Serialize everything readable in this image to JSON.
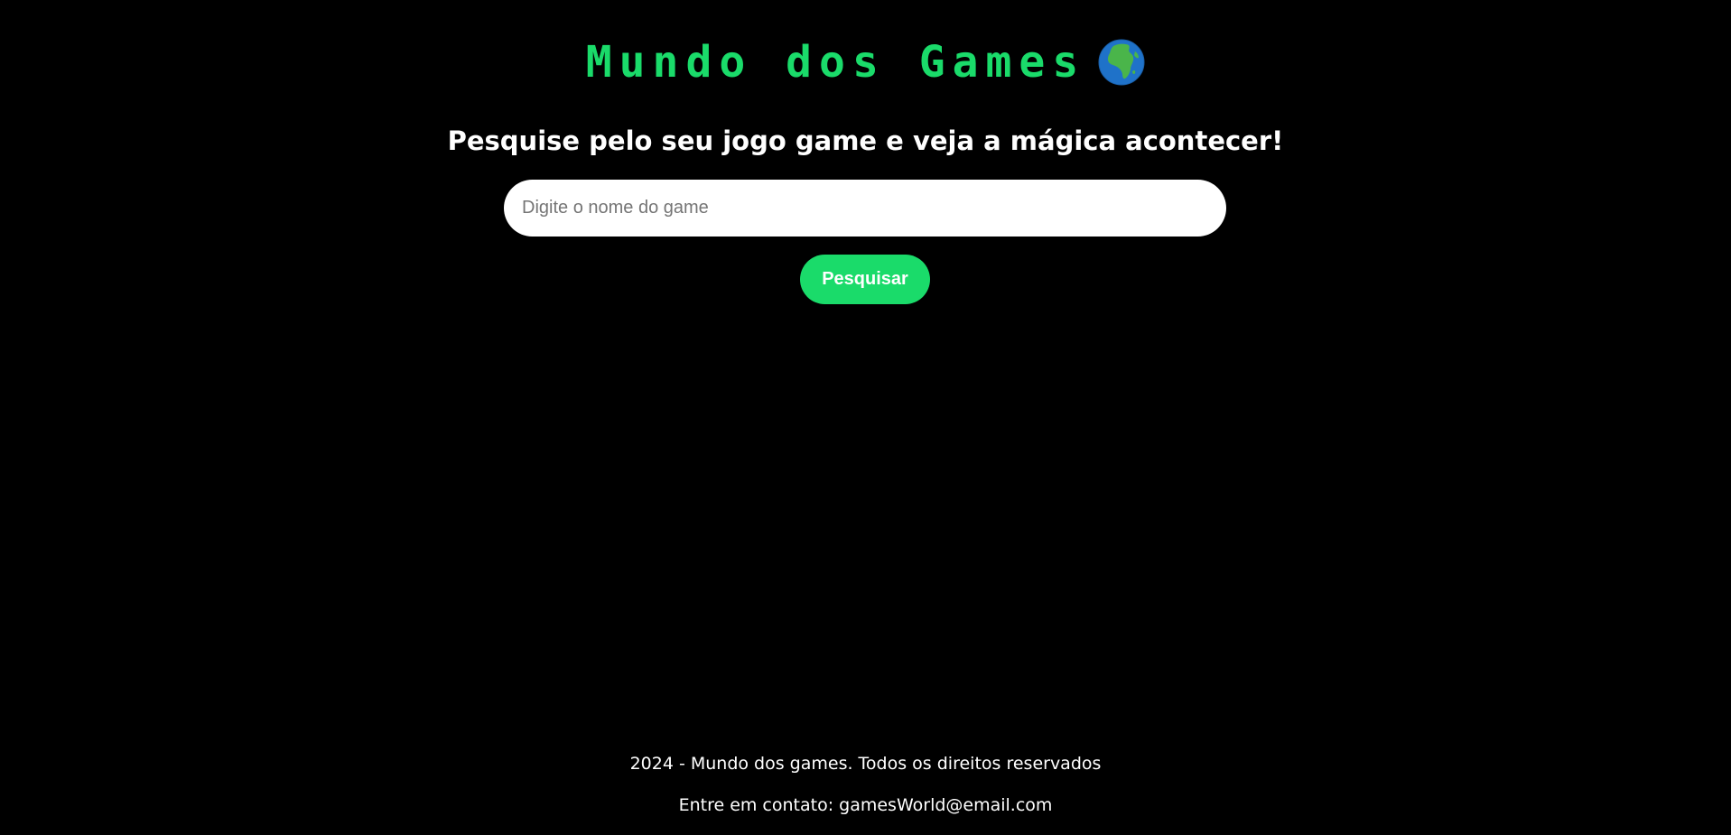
{
  "header": {
    "title": "Mundo dos Games",
    "title_icon": "globe-africa-icon",
    "title_color": "#1adb6a"
  },
  "main": {
    "subtitle": "Pesquise pelo seu jogo game e veja a mágica acontecer!",
    "search": {
      "placeholder": "Digite o nome do game",
      "value": ""
    },
    "search_button_label": "Pesquisar",
    "accent_color": "#1adb6a"
  },
  "footer": {
    "copyright": "2024 - Mundo dos games. Todos os direitos reservados",
    "contact": "Entre em contato: gamesWorld@email.com"
  }
}
